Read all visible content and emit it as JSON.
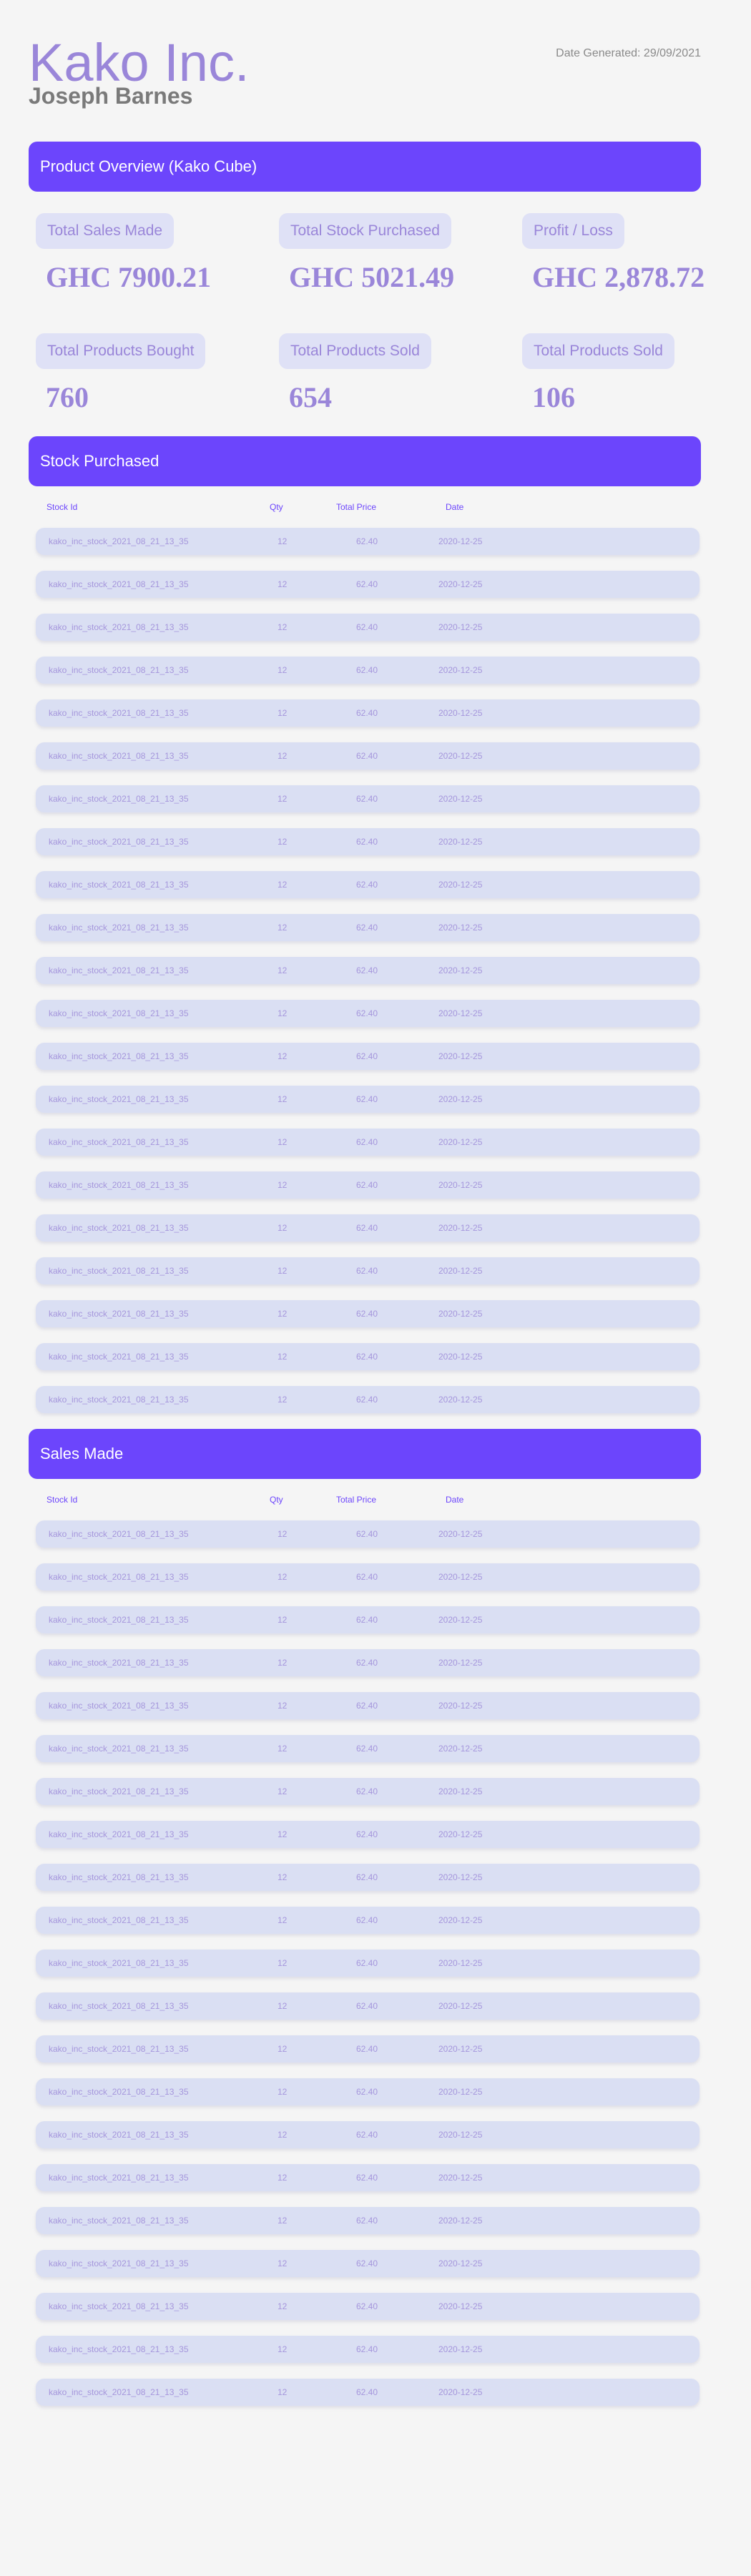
{
  "header": {
    "company": "Kako Inc.",
    "person": "Joseph Barnes",
    "date_generated": "Date Generated: 29/09/2021"
  },
  "overview": {
    "title": "Product Overview (Kako Cube)",
    "stats": [
      {
        "label": "Total Sales Made",
        "value": "GHC 7900.21"
      },
      {
        "label": "Total Stock Purchased",
        "value": "GHC 5021.49"
      },
      {
        "label": "Profit / Loss",
        "value": "GHC 2,878.72"
      },
      {
        "label": "Total Products Bought",
        "value": "760"
      },
      {
        "label": "Total Products Sold",
        "value": "654"
      },
      {
        "label": "Total Products Sold",
        "value": "106"
      }
    ]
  },
  "stock_purchased": {
    "title": "Stock Purchased",
    "columns": [
      "Stock Id",
      "Qty",
      "Total Price",
      "Date"
    ],
    "rows": [
      [
        "kako_inc_stock_2021_08_21_13_35",
        "12",
        "62.40",
        "2020-12-25"
      ],
      [
        "kako_inc_stock_2021_08_21_13_35",
        "12",
        "62.40",
        "2020-12-25"
      ],
      [
        "kako_inc_stock_2021_08_21_13_35",
        "12",
        "62.40",
        "2020-12-25"
      ],
      [
        "kako_inc_stock_2021_08_21_13_35",
        "12",
        "62.40",
        "2020-12-25"
      ],
      [
        "kako_inc_stock_2021_08_21_13_35",
        "12",
        "62.40",
        "2020-12-25"
      ],
      [
        "kako_inc_stock_2021_08_21_13_35",
        "12",
        "62.40",
        "2020-12-25"
      ],
      [
        "kako_inc_stock_2021_08_21_13_35",
        "12",
        "62.40",
        "2020-12-25"
      ],
      [
        "kako_inc_stock_2021_08_21_13_35",
        "12",
        "62.40",
        "2020-12-25"
      ],
      [
        "kako_inc_stock_2021_08_21_13_35",
        "12",
        "62.40",
        "2020-12-25"
      ],
      [
        "kako_inc_stock_2021_08_21_13_35",
        "12",
        "62.40",
        "2020-12-25"
      ],
      [
        "kako_inc_stock_2021_08_21_13_35",
        "12",
        "62.40",
        "2020-12-25"
      ],
      [
        "kako_inc_stock_2021_08_21_13_35",
        "12",
        "62.40",
        "2020-12-25"
      ],
      [
        "kako_inc_stock_2021_08_21_13_35",
        "12",
        "62.40",
        "2020-12-25"
      ],
      [
        "kako_inc_stock_2021_08_21_13_35",
        "12",
        "62.40",
        "2020-12-25"
      ],
      [
        "kako_inc_stock_2021_08_21_13_35",
        "12",
        "62.40",
        "2020-12-25"
      ],
      [
        "kako_inc_stock_2021_08_21_13_35",
        "12",
        "62.40",
        "2020-12-25"
      ],
      [
        "kako_inc_stock_2021_08_21_13_35",
        "12",
        "62.40",
        "2020-12-25"
      ],
      [
        "kako_inc_stock_2021_08_21_13_35",
        "12",
        "62.40",
        "2020-12-25"
      ],
      [
        "kako_inc_stock_2021_08_21_13_35",
        "12",
        "62.40",
        "2020-12-25"
      ],
      [
        "kako_inc_stock_2021_08_21_13_35",
        "12",
        "62.40",
        "2020-12-25"
      ],
      [
        "kako_inc_stock_2021_08_21_13_35",
        "12",
        "62.40",
        "2020-12-25"
      ]
    ]
  },
  "sales_made": {
    "title": "Sales Made",
    "columns": [
      "Stock Id",
      "Qty",
      "Total Price",
      "Date"
    ],
    "rows": [
      [
        "kako_inc_stock_2021_08_21_13_35",
        "12",
        "62.40",
        "2020-12-25"
      ],
      [
        "kako_inc_stock_2021_08_21_13_35",
        "12",
        "62.40",
        "2020-12-25"
      ],
      [
        "kako_inc_stock_2021_08_21_13_35",
        "12",
        "62.40",
        "2020-12-25"
      ],
      [
        "kako_inc_stock_2021_08_21_13_35",
        "12",
        "62.40",
        "2020-12-25"
      ],
      [
        "kako_inc_stock_2021_08_21_13_35",
        "12",
        "62.40",
        "2020-12-25"
      ],
      [
        "kako_inc_stock_2021_08_21_13_35",
        "12",
        "62.40",
        "2020-12-25"
      ],
      [
        "kako_inc_stock_2021_08_21_13_35",
        "12",
        "62.40",
        "2020-12-25"
      ],
      [
        "kako_inc_stock_2021_08_21_13_35",
        "12",
        "62.40",
        "2020-12-25"
      ],
      [
        "kako_inc_stock_2021_08_21_13_35",
        "12",
        "62.40",
        "2020-12-25"
      ],
      [
        "kako_inc_stock_2021_08_21_13_35",
        "12",
        "62.40",
        "2020-12-25"
      ],
      [
        "kako_inc_stock_2021_08_21_13_35",
        "12",
        "62.40",
        "2020-12-25"
      ],
      [
        "kako_inc_stock_2021_08_21_13_35",
        "12",
        "62.40",
        "2020-12-25"
      ],
      [
        "kako_inc_stock_2021_08_21_13_35",
        "12",
        "62.40",
        "2020-12-25"
      ],
      [
        "kako_inc_stock_2021_08_21_13_35",
        "12",
        "62.40",
        "2020-12-25"
      ],
      [
        "kako_inc_stock_2021_08_21_13_35",
        "12",
        "62.40",
        "2020-12-25"
      ],
      [
        "kako_inc_stock_2021_08_21_13_35",
        "12",
        "62.40",
        "2020-12-25"
      ],
      [
        "kako_inc_stock_2021_08_21_13_35",
        "12",
        "62.40",
        "2020-12-25"
      ],
      [
        "kako_inc_stock_2021_08_21_13_35",
        "12",
        "62.40",
        "2020-12-25"
      ],
      [
        "kako_inc_stock_2021_08_21_13_35",
        "12",
        "62.40",
        "2020-12-25"
      ],
      [
        "kako_inc_stock_2021_08_21_13_35",
        "12",
        "62.40",
        "2020-12-25"
      ],
      [
        "kako_inc_stock_2021_08_21_13_35",
        "12",
        "62.40",
        "2020-12-25"
      ]
    ]
  },
  "colors": {
    "accent": "#6c45fc",
    "text_accent": "#9a86d9",
    "row_background": "#dadff3",
    "label_background": "#dfe1f6",
    "page_background": "#f5f5f5"
  }
}
